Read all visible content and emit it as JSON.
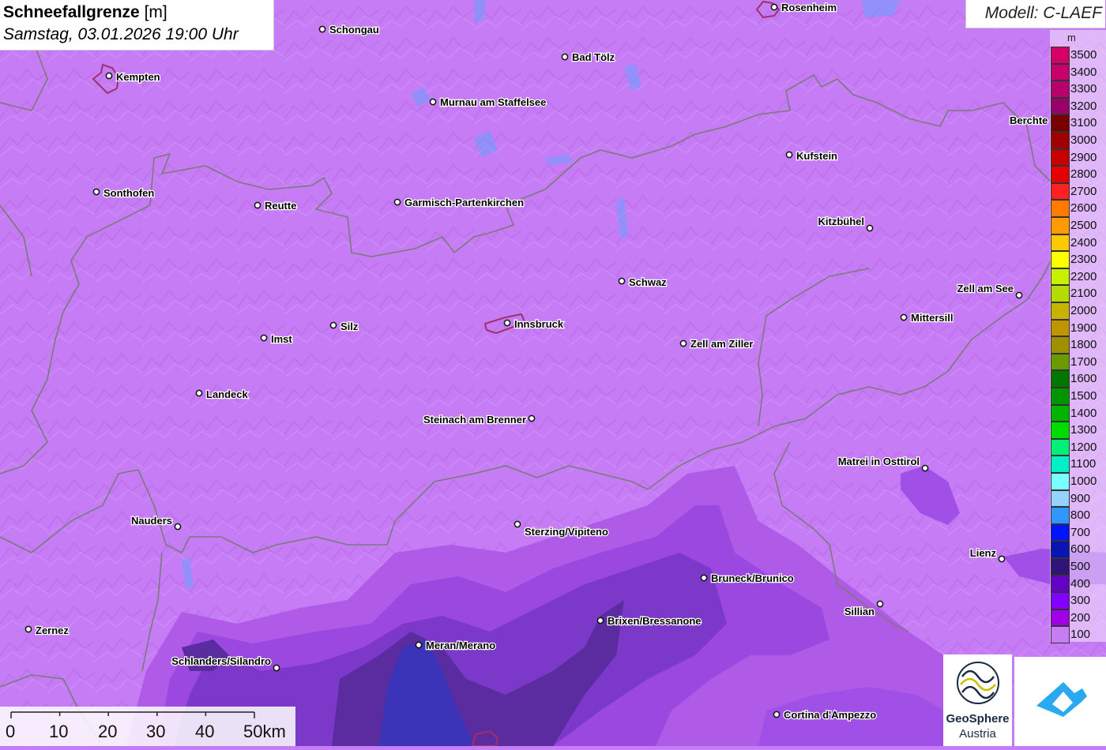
{
  "header": {
    "title_main": "Schneefallgrenze",
    "title_unit": "[m]",
    "datetime": "Samstag, 03.01.2026 19:00 Uhr"
  },
  "model": {
    "label": "Modell: C-LAEF"
  },
  "legend": {
    "unit": "m",
    "levels": [
      {
        "value": "3500",
        "color": "#d40068"
      },
      {
        "value": "3400",
        "color": "#c8006a"
      },
      {
        "value": "3300",
        "color": "#b8006c"
      },
      {
        "value": "3200",
        "color": "#98006a"
      },
      {
        "value": "3100",
        "color": "#780000"
      },
      {
        "value": "3000",
        "color": "#a00000"
      },
      {
        "value": "2900",
        "color": "#c80000"
      },
      {
        "value": "2800",
        "color": "#e40000"
      },
      {
        "value": "2700",
        "color": "#ff2020"
      },
      {
        "value": "2600",
        "color": "#ff7a00"
      },
      {
        "value": "2500",
        "color": "#ff9a00"
      },
      {
        "value": "2400",
        "color": "#ffc800"
      },
      {
        "value": "2300",
        "color": "#ffff00"
      },
      {
        "value": "2200",
        "color": "#c8f000"
      },
      {
        "value": "2100",
        "color": "#b4dc00"
      },
      {
        "value": "2000",
        "color": "#c8b400"
      },
      {
        "value": "1900",
        "color": "#c09600"
      },
      {
        "value": "1800",
        "color": "#a09000"
      },
      {
        "value": "1700",
        "color": "#6a9a00"
      },
      {
        "value": "1600",
        "color": "#007800"
      },
      {
        "value": "1500",
        "color": "#009600"
      },
      {
        "value": "1400",
        "color": "#00b400"
      },
      {
        "value": "1300",
        "color": "#00dc00"
      },
      {
        "value": "1200",
        "color": "#00f078"
      },
      {
        "value": "1100",
        "color": "#00f0c8"
      },
      {
        "value": "1000",
        "color": "#78ffff"
      },
      {
        "value": "900",
        "color": "#96d2ff"
      },
      {
        "value": "800",
        "color": "#3296ff"
      },
      {
        "value": "700",
        "color": "#0014ff"
      },
      {
        "value": "600",
        "color": "#0a14b4"
      },
      {
        "value": "500",
        "color": "#321478"
      },
      {
        "value": "400",
        "color": "#6400c8"
      },
      {
        "value": "300",
        "color": "#8200ff"
      },
      {
        "value": "200",
        "color": "#a000e6"
      },
      {
        "value": "100",
        "color": "#c67cf5"
      }
    ]
  },
  "scale_bar": {
    "labels": [
      "0",
      "10",
      "20",
      "30",
      "40",
      "50km"
    ]
  },
  "cities": [
    {
      "name": "Rosenheim"
    },
    {
      "name": "Schongau"
    },
    {
      "name": "Bad Tölz"
    },
    {
      "name": "Kempten"
    },
    {
      "name": "Murnau am Staffelsee"
    },
    {
      "name": "Berchte"
    },
    {
      "name": "Kufstein"
    },
    {
      "name": "Sonthofen"
    },
    {
      "name": "Reutte"
    },
    {
      "name": "Garmisch-Partenkirchen"
    },
    {
      "name": "Kitzbühel"
    },
    {
      "name": "Schwaz"
    },
    {
      "name": "Zell am See"
    },
    {
      "name": "Mittersill"
    },
    {
      "name": "Innsbruck"
    },
    {
      "name": "Silz"
    },
    {
      "name": "Imst"
    },
    {
      "name": "Zell am Ziller"
    },
    {
      "name": "Landeck"
    },
    {
      "name": "Steinach am Brenner"
    },
    {
      "name": "Matrei in Osttirol"
    },
    {
      "name": "Nauders"
    },
    {
      "name": "Sterzing/Vipiteno"
    },
    {
      "name": "Lienz"
    },
    {
      "name": "Bruneck/Brunico"
    },
    {
      "name": "Sillian"
    },
    {
      "name": "Zernez"
    },
    {
      "name": "Brixen/Bressanone"
    },
    {
      "name": "Meran/Merano"
    },
    {
      "name": "Schlanders/Silandro"
    },
    {
      "name": "Cortina d'Ampezzo"
    }
  ],
  "logos": {
    "geosphere_line1": "GeoSphere",
    "geosphere_line2": "Austria"
  }
}
